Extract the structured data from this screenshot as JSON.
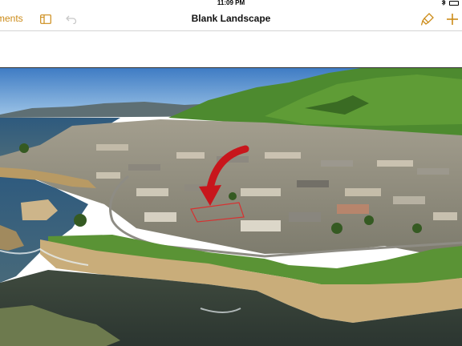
{
  "status_bar": {
    "time": "11:09 PM"
  },
  "toolbar": {
    "back_label": "ments",
    "title": "Blank Landscape"
  },
  "colors": {
    "accent": "#cc8b18",
    "sky": "#5b8ec9",
    "ocean": "#3a5a6e",
    "hills": "#4f8a2e"
  },
  "icons": [
    "sidebar-icon",
    "undo-icon",
    "brush-icon",
    "add-icon",
    "arrow-icon",
    "bluetooth-icon",
    "battery-icon"
  ]
}
